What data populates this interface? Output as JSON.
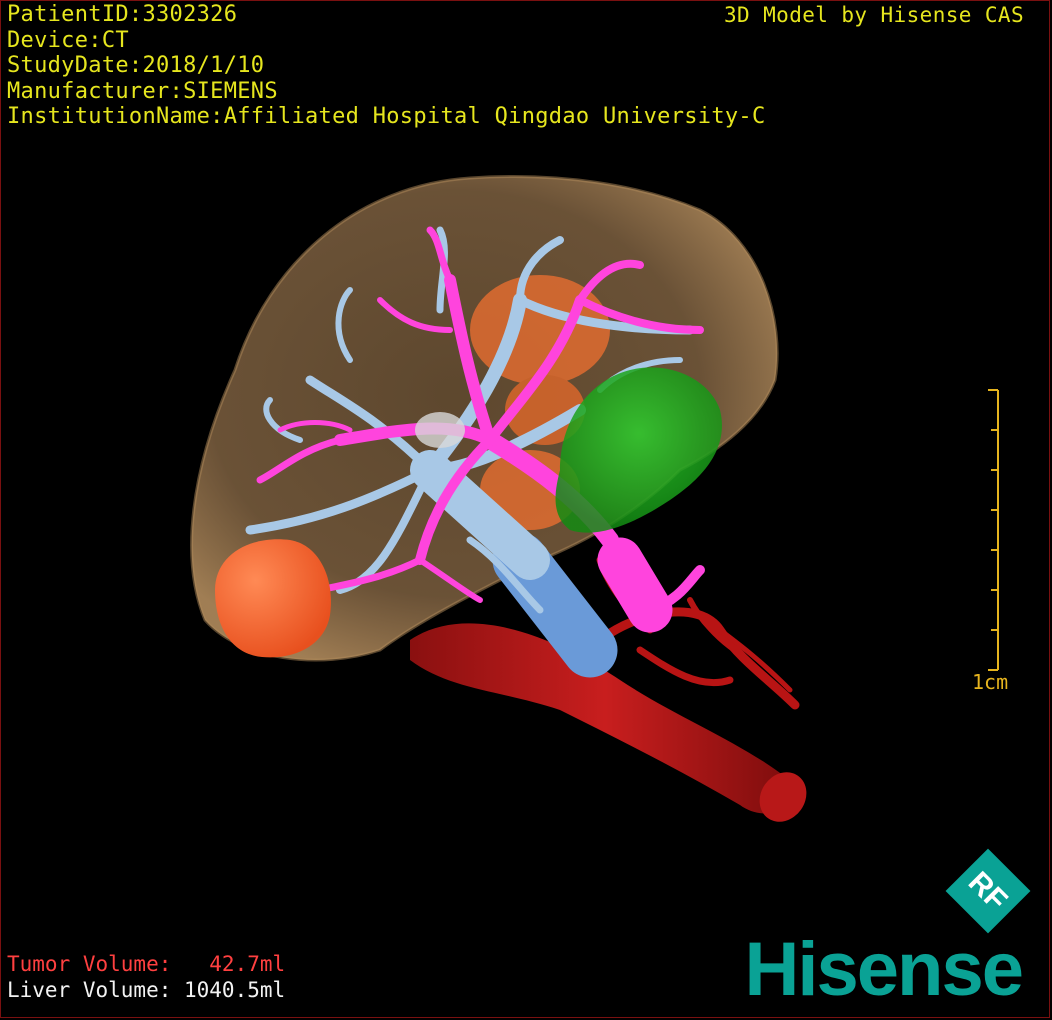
{
  "patient_info": {
    "patient_id": "PatientID:3302326",
    "device": "Device:CT",
    "study_date": "StudyDate:2018/1/10",
    "manufacturer": "Manufacturer:SIEMENS",
    "institution": "InstitutionName:Affiliated Hospital Qingdao University-C"
  },
  "credit": "3D Model by Hisense CAS",
  "scale_bar": {
    "label": "1cm"
  },
  "volumes": {
    "tumor": "Tumor Volume:   42.7ml",
    "liver": "Liver Volume: 1040.5ml"
  },
  "branding": {
    "logo_text": "Hisense",
    "badge_text": "RF"
  },
  "colors": {
    "text_info": "#e6e61e",
    "tumor_text": "#ff4040",
    "liver": "#8a6a45",
    "tumor": "#ff6a30",
    "hepatic_vein": "#a8c8e6",
    "portal_vein": "#ff44dd",
    "artery_ivc": "#c41818",
    "gallbladder": "#1aa81a",
    "brand": "#0aa295"
  }
}
